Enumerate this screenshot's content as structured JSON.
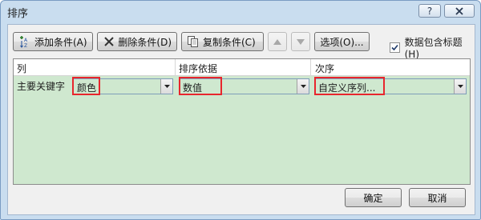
{
  "window": {
    "title": "排序",
    "help_glyph": "?",
    "help_icon": "question-mark-icon",
    "close_icon": "close-icon"
  },
  "toolbar": {
    "add_label": "添加条件(A)",
    "add_icon": "add-level-icon",
    "delete_label": "删除条件(D)",
    "delete_icon": "x-delete-icon",
    "copy_label": "复制条件(C)",
    "copy_icon": "copy-icon",
    "move_up_icon": "triangle-up-icon",
    "move_down_icon": "triangle-down-icon",
    "options_label": "选项(O)...",
    "header_checkbox_label": "数据包含标题(H)",
    "header_checkbox_checked": true
  },
  "grid": {
    "columns": [
      "列",
      "排序依据",
      "次序"
    ],
    "rows": [
      {
        "label": "主要关键字",
        "column_value": "颜色",
        "sort_on_value": "数值",
        "order_value": "自定义序列..."
      }
    ],
    "row_background": "#cfe8cf",
    "highlight_color": "#e8262d"
  },
  "footer": {
    "ok_label": "确定",
    "cancel_label": "取消"
  }
}
